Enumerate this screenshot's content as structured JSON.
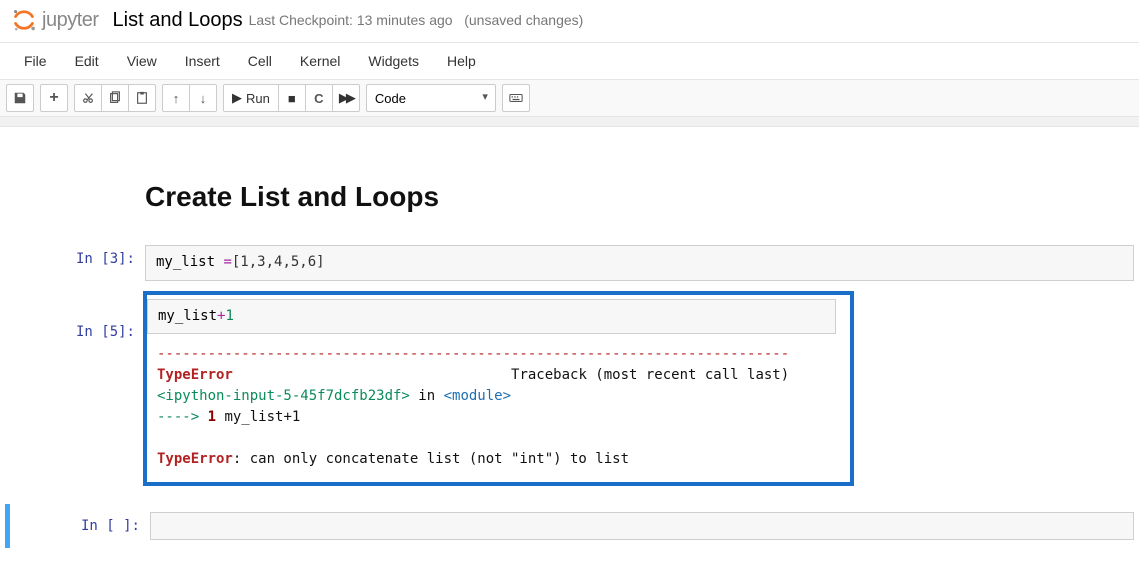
{
  "header": {
    "logo_text": "jupyter",
    "title": "List and Loops",
    "checkpoint_prefix": "Last Checkpoint:",
    "checkpoint_time": "13 minutes ago",
    "unsaved": "(unsaved changes)"
  },
  "menubar": {
    "items": [
      "File",
      "Edit",
      "View",
      "Insert",
      "Cell",
      "Kernel",
      "Widgets",
      "Help"
    ]
  },
  "toolbar": {
    "run_label": "Run",
    "cell_type_selected": "Code"
  },
  "notebook": {
    "heading": "Create List and Loops",
    "cells": [
      {
        "prompt": "In [3]:",
        "code_prefix": "my_list ",
        "code_op": "=",
        "code_list": "[1,3,4,5,6]"
      },
      {
        "prompt": "In [5]:",
        "code_prefix": "my_list",
        "code_op": "+",
        "code_num": "1",
        "output": {
          "sep": "---------------------------------------------------------------------------",
          "err_name": "TypeError",
          "traceback_label": "Traceback (most recent call last)",
          "ipy_ref": "<ipython-input-5-45f7dcfb23df>",
          "in_label": " in ",
          "module_ref": "<module>",
          "arrow_line_pre": "----> ",
          "arrow_line_num": "1",
          "arrow_line_code": " my_list+1",
          "final_err": "TypeError",
          "final_msg": ": can only concatenate list (not \"int\") to list"
        }
      },
      {
        "prompt": "In [ ]:"
      }
    ]
  }
}
